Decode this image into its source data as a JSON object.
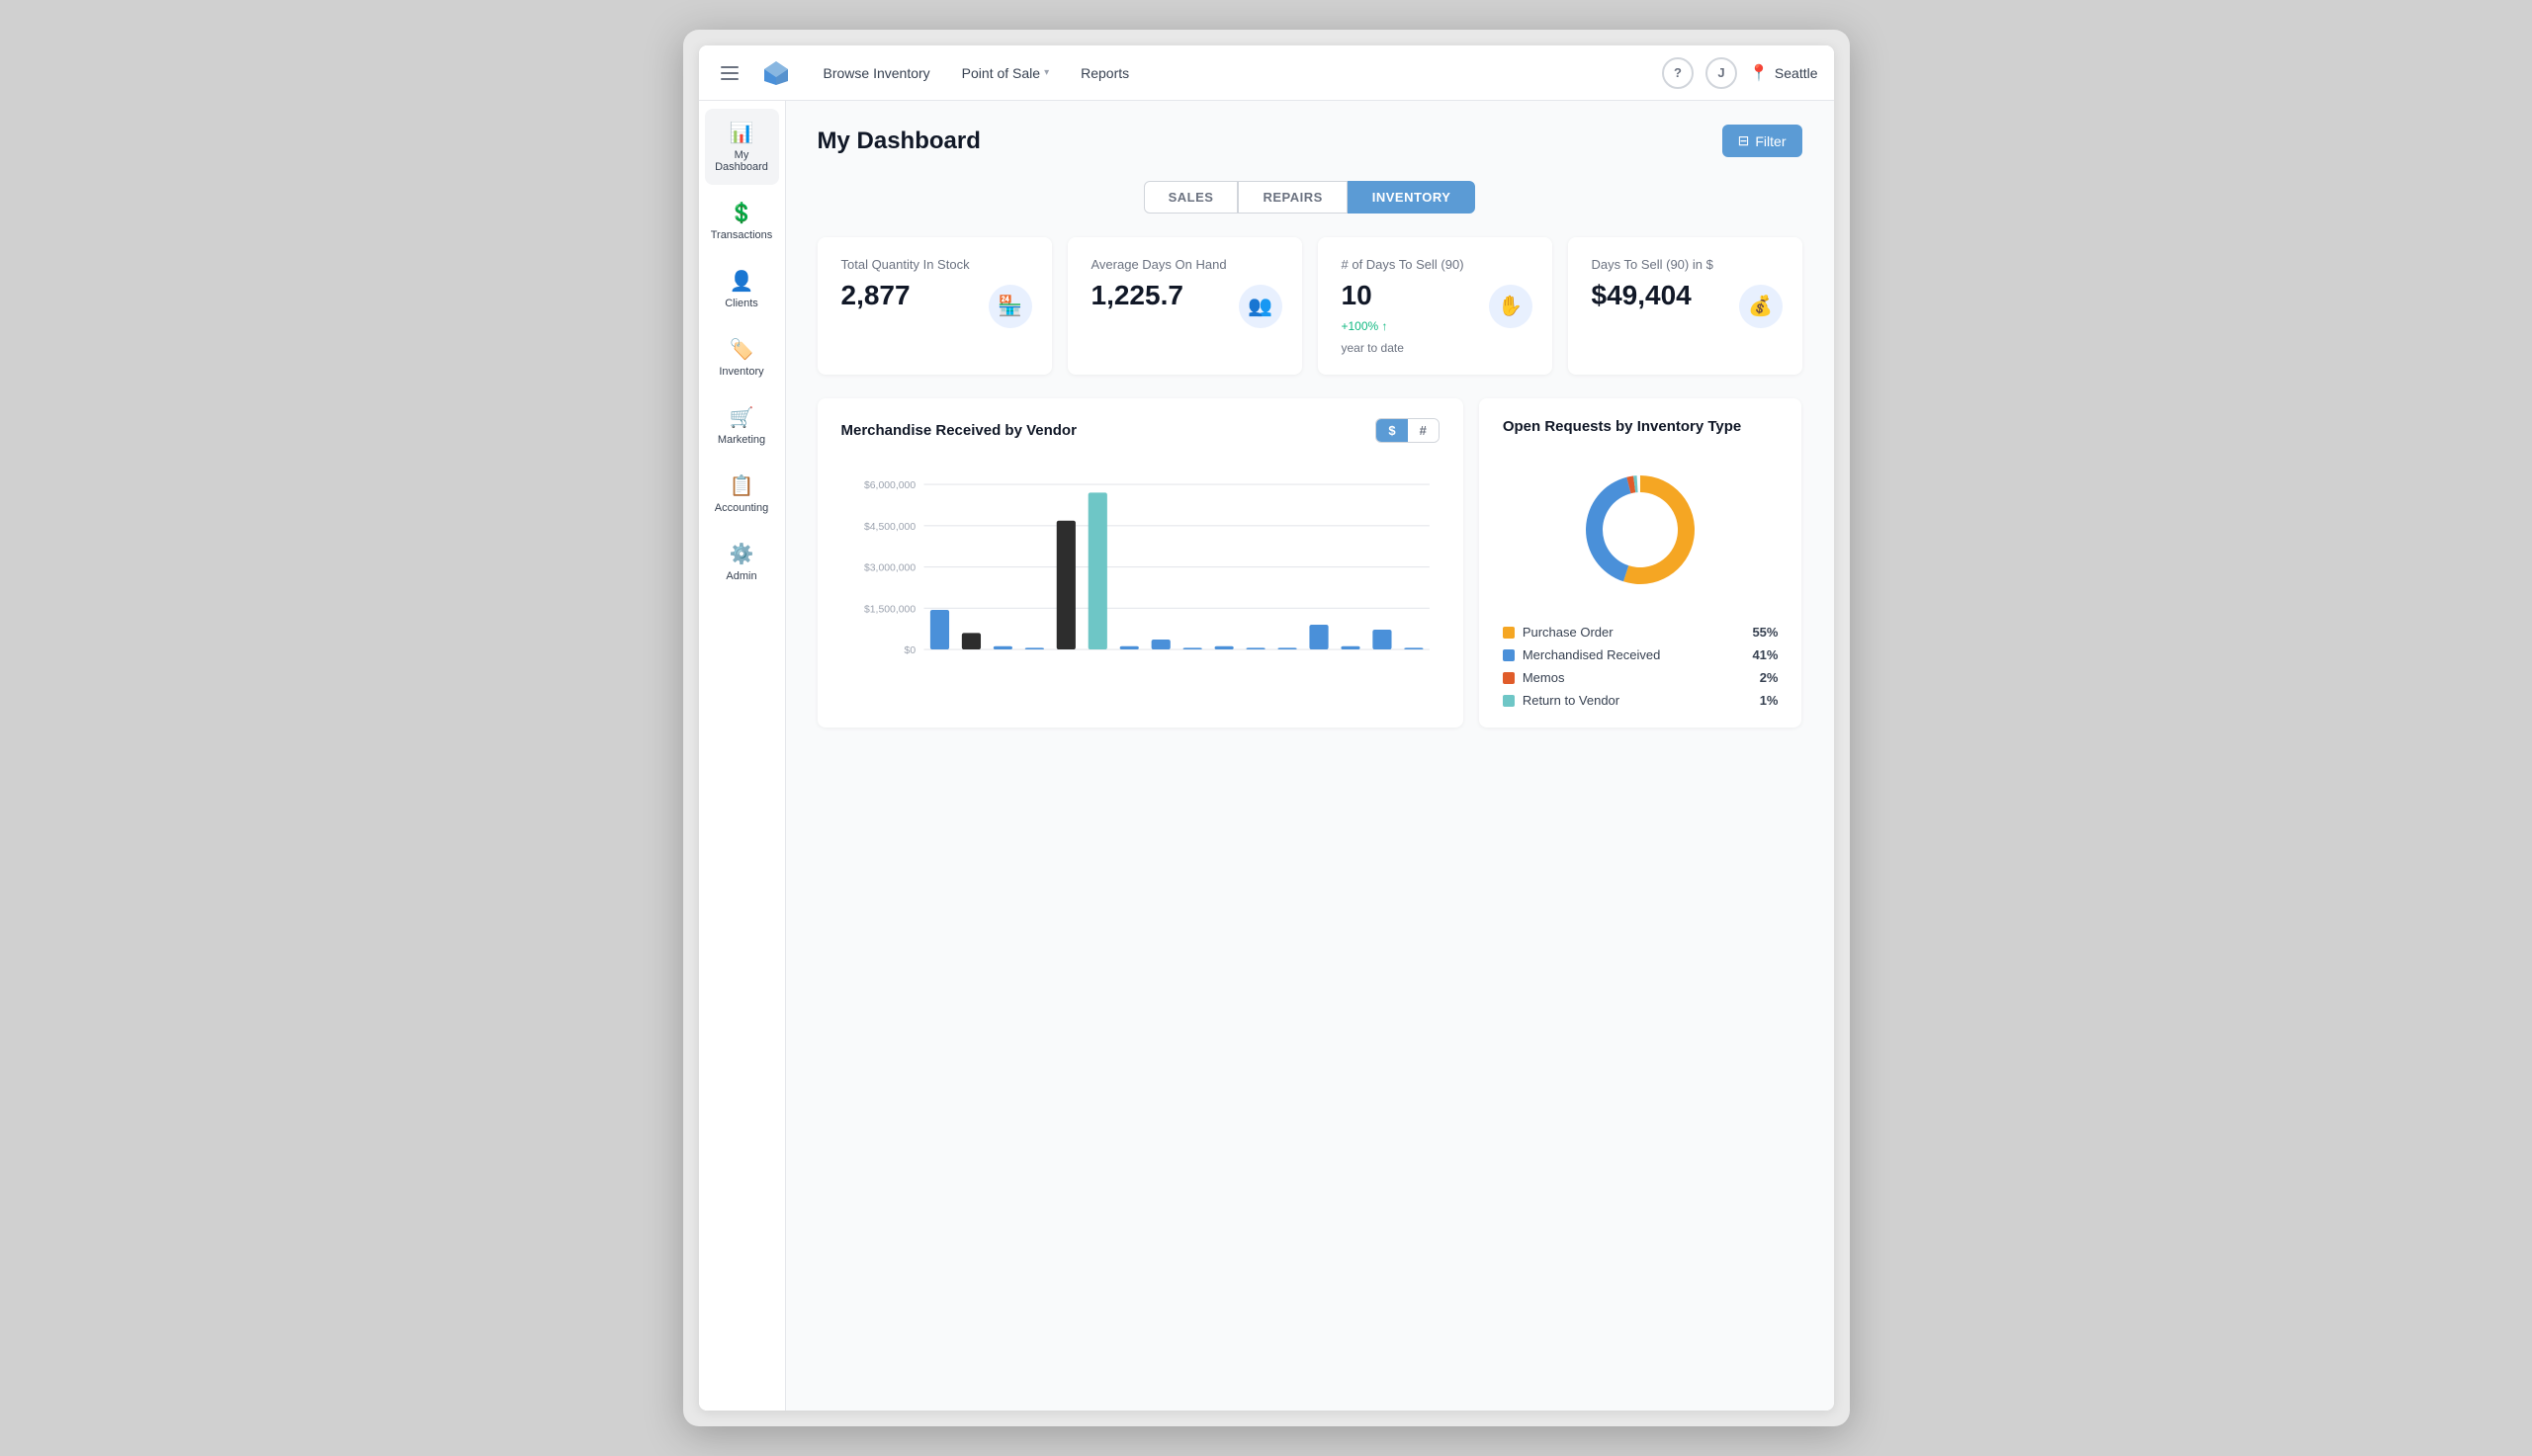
{
  "nav": {
    "hamburger_label": "menu",
    "logo_alt": "logo",
    "links": [
      {
        "id": "browse-inventory",
        "label": "Browse Inventory",
        "active": false
      },
      {
        "id": "point-of-sale",
        "label": "Point of Sale",
        "active": false,
        "has_dropdown": true
      },
      {
        "id": "reports",
        "label": "Reports",
        "active": false
      }
    ],
    "help_label": "?",
    "user_initial": "J",
    "location": "Seattle"
  },
  "sidebar": {
    "items": [
      {
        "id": "dashboard",
        "label": "My Dashboard",
        "icon": "📊",
        "active": true
      },
      {
        "id": "transactions",
        "label": "Transactions",
        "icon": "💲"
      },
      {
        "id": "clients",
        "label": "Clients",
        "icon": "👤"
      },
      {
        "id": "inventory",
        "label": "Inventory",
        "icon": "🏷️"
      },
      {
        "id": "marketing",
        "label": "Marketing",
        "icon": "🛒"
      },
      {
        "id": "accounting",
        "label": "Accounting",
        "icon": "📋"
      },
      {
        "id": "admin",
        "label": "Admin",
        "icon": "⚙️"
      }
    ]
  },
  "page": {
    "title": "My Dashboard",
    "filter_label": "Filter"
  },
  "tabs": [
    {
      "id": "sales",
      "label": "SALES",
      "active": false
    },
    {
      "id": "repairs",
      "label": "REPAIRS",
      "active": false
    },
    {
      "id": "inventory",
      "label": "INVENTORY",
      "active": true
    }
  ],
  "stats": [
    {
      "id": "total-qty",
      "label": "Total Quantity In Stock",
      "value": "2,877",
      "icon": "🏪",
      "trend": null
    },
    {
      "id": "avg-days",
      "label": "Average Days On Hand",
      "value": "1,225.7",
      "icon": "👥",
      "trend": null
    },
    {
      "id": "days-to-sell",
      "label": "# of Days To Sell (90)",
      "value": "10",
      "icon": "✋",
      "trend": "+100%",
      "trend_label": "year to date"
    },
    {
      "id": "days-to-sell-dollar",
      "label": "Days To Sell (90) in $",
      "value": "$49,404",
      "icon": "💰",
      "trend": null
    }
  ],
  "bar_chart": {
    "title": "Merchandise Received by Vendor",
    "toggle_dollar": "$",
    "toggle_hash": "#",
    "y_labels": [
      "$6,000,000",
      "$4,500,000",
      "$3,000,000",
      "$1,500,000",
      "$0"
    ],
    "bars": [
      {
        "height": 0.24,
        "color": "#4a90d9"
      },
      {
        "height": 0.1,
        "color": "#2d2d2d"
      },
      {
        "height": 0.02,
        "color": "#4a90d9"
      },
      {
        "height": 0.01,
        "color": "#4a90d9"
      },
      {
        "height": 0.78,
        "color": "#2d2d2d"
      },
      {
        "height": 0.95,
        "color": "#6ec6c6"
      },
      {
        "height": 0.02,
        "color": "#4a90d9"
      },
      {
        "height": 0.06,
        "color": "#4a90d9"
      },
      {
        "height": 0.01,
        "color": "#4a90d9"
      },
      {
        "height": 0.02,
        "color": "#4a90d9"
      },
      {
        "height": 0.01,
        "color": "#4a90d9"
      },
      {
        "height": 0.01,
        "color": "#4a90d9"
      },
      {
        "height": 0.15,
        "color": "#4a90d9"
      },
      {
        "height": 0.02,
        "color": "#4a90d9"
      },
      {
        "height": 0.12,
        "color": "#4a90d9"
      },
      {
        "height": 0.01,
        "color": "#4a90d9"
      }
    ]
  },
  "donut_chart": {
    "title": "Open Requests by Inventory Type",
    "segments": [
      {
        "label": "Purchase Order",
        "color": "#f5a623",
        "pct": 55,
        "value": 0.55
      },
      {
        "label": "Merchandised Received",
        "color": "#4a90d9",
        "pct": 41,
        "value": 0.41
      },
      {
        "label": "Memos",
        "color": "#e05c2a",
        "pct": 2,
        "value": 0.02
      },
      {
        "label": "Return to Vendor",
        "color": "#6ec6c6",
        "pct": 1,
        "value": 0.01
      }
    ]
  }
}
